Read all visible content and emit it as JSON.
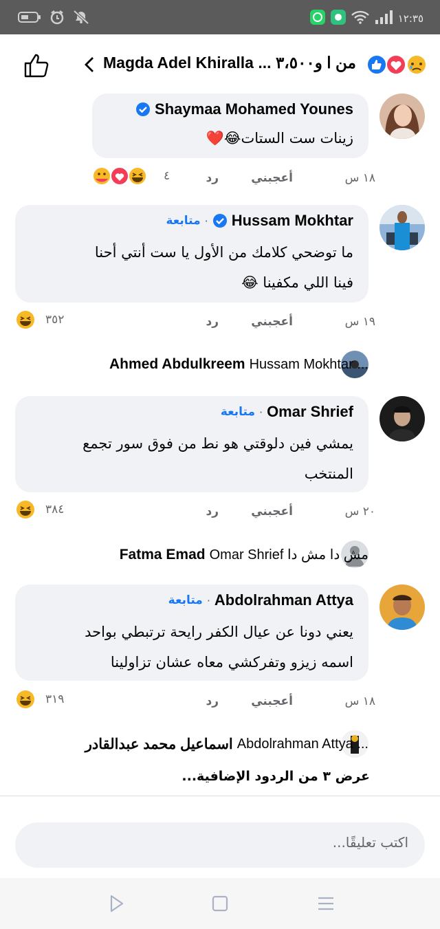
{
  "status_bar": {
    "time": "١٢:٣٥",
    "left_icons": [
      "battery-icon",
      "alarm-icon",
      "mute-icon"
    ],
    "right_icons": [
      "whatsapp-icon",
      "app-icon",
      "wifi-icon",
      "signal-icon"
    ]
  },
  "header": {
    "title": "Magda Adel Khiralla ... من ا",
    "reaction_count": "و٣،٥٠٠",
    "reactions": [
      "like-reaction-icon",
      "love-reaction-icon",
      "sad-reaction-icon"
    ]
  },
  "comments": [
    {
      "author": "Shaymaa Mohamed Younes",
      "verified": true,
      "follow": "",
      "text_lines": [
        "زينات ست الستات😂❤️"
      ],
      "time": "١٨ س",
      "like": "أعجبني",
      "reply": "رد",
      "reaction_count": "٤",
      "reactions": [
        "haha",
        "love",
        "care"
      ]
    },
    {
      "author": "Hussam Mokhtar",
      "verified": true,
      "follow": "متابعة",
      "text_lines": [
        "ما توضحي كلامك من الأول يا ست أنتي  أحنا",
        "فينا اللي مكفينا 😂"
      ],
      "time": "١٩ س",
      "like": "أعجبني",
      "reply": "رد",
      "reaction_count": "٣٥٢",
      "reactions": [
        "haha"
      ]
    },
    {
      "author": "Omar Shrief",
      "verified": false,
      "follow": "متابعة",
      "text_lines": [
        "يمشي فين دلوقتي هو نط من فوق سور تجمع",
        "المنتخب"
      ],
      "time": "٢٠ س",
      "like": "أعجبني",
      "reply": "رد",
      "reaction_count": "٣٨٤",
      "reactions": [
        "haha"
      ]
    },
    {
      "author": "Abdolrahman Attya",
      "verified": false,
      "follow": "متابعة",
      "text_lines": [
        "يعني دونا عن عيال الكفر رايحة ترتبطي بواحد",
        "اسمه زيزو وتفركشي معاه عشان تزاولينا"
      ],
      "time": "١٨ س",
      "like": "أعجبني",
      "reply": "رد",
      "reaction_count": "٣١٩",
      "reactions": [
        "haha"
      ]
    }
  ],
  "replies": [
    {
      "name": "Ahmed Abdulkreem",
      "snippet": "Hussam Mokhtar ..."
    },
    {
      "name": "Fatma Emad",
      "snippet": "Omar Shrief مش دا مش دا"
    },
    {
      "name": "اسماعيل محمد عبدالقادر",
      "snippet": "Abdolrahman Attya ..."
    }
  ],
  "more_replies": "عرض ٣ من الردود الإضافية...",
  "composer": {
    "placeholder": "اكتب تعليقًا..."
  },
  "nav": [
    "back-nav-icon",
    "home-nav-icon",
    "recents-nav-icon"
  ],
  "colors": {
    "accent": "#1877f2",
    "bubble": "#f0f2f5",
    "secondary_text": "#65676b",
    "status_bar": "#5b5b5b",
    "haha": "#f7b928",
    "love": "#f33e58"
  }
}
